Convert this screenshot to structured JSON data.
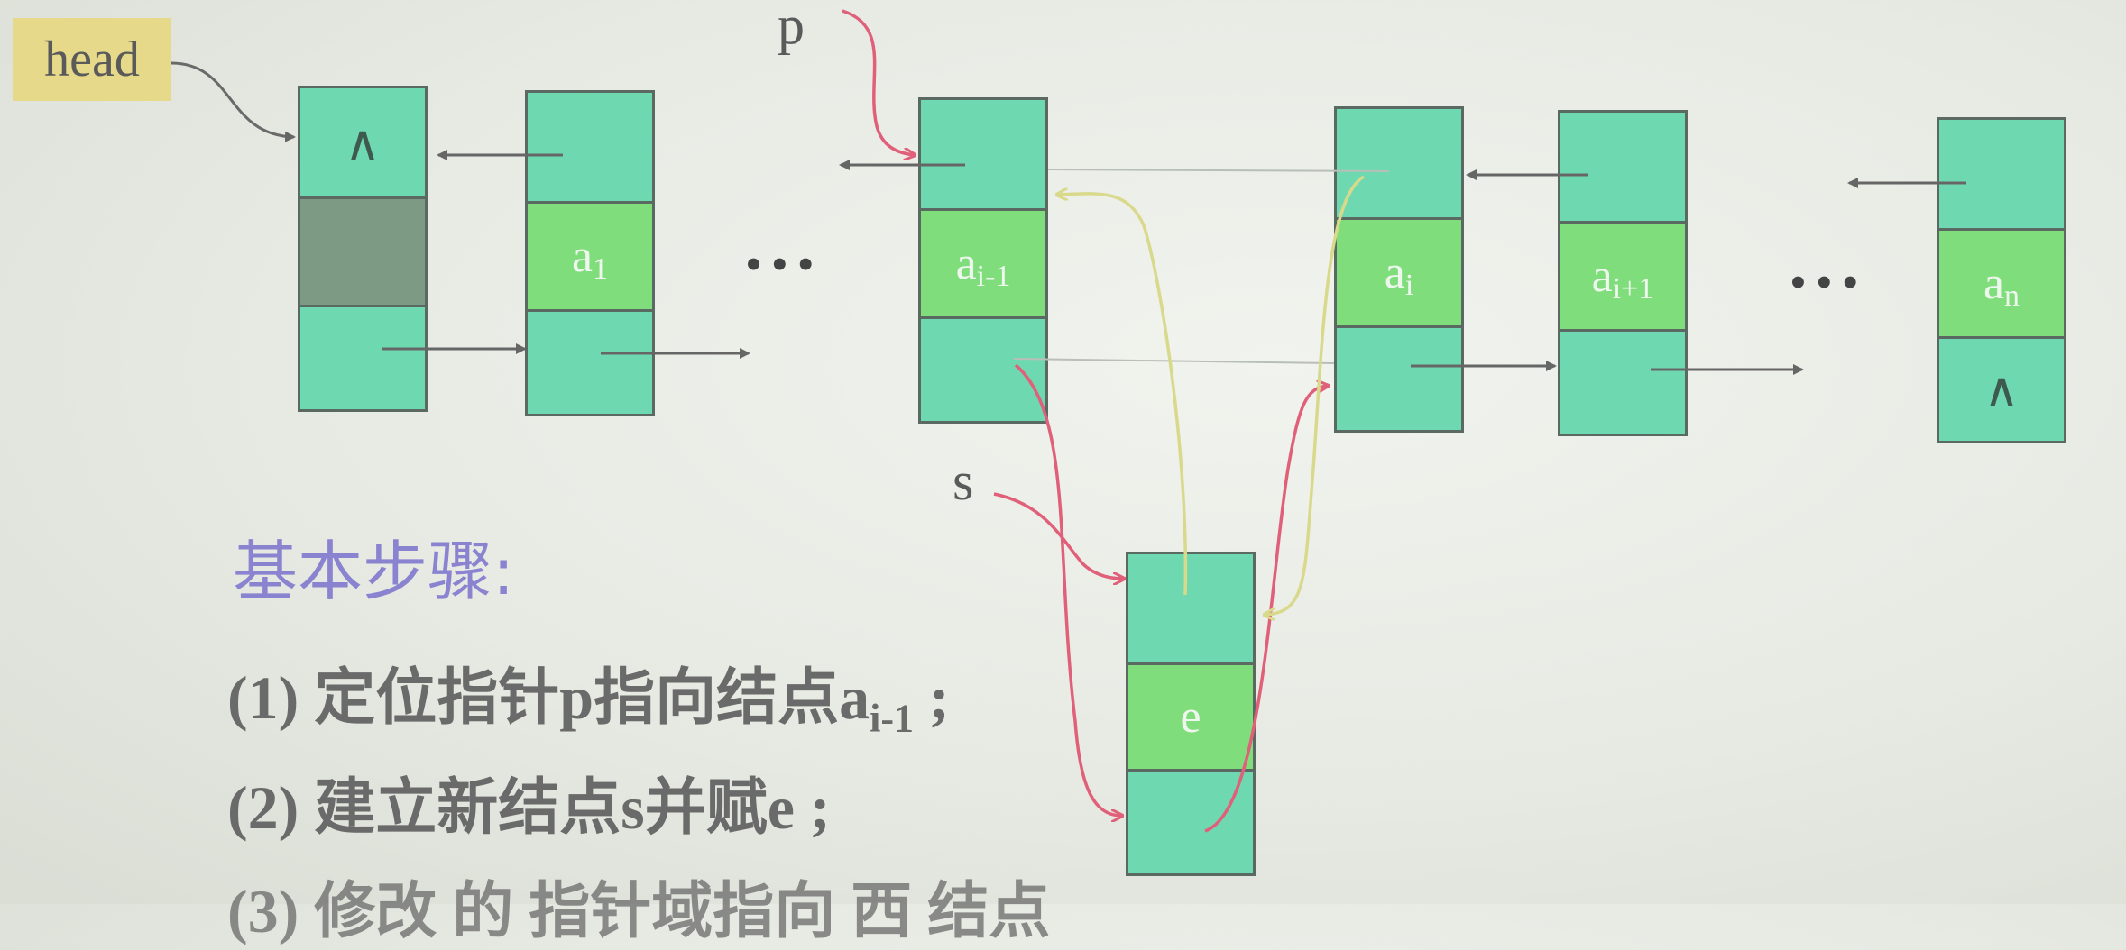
{
  "labels": {
    "head": "head",
    "p": "p",
    "s": "s",
    "ellipsis": "•••"
  },
  "nodes": {
    "head_node": {
      "prior": "∧",
      "data": "",
      "next": ""
    },
    "a1": {
      "data": "a",
      "sub": "1"
    },
    "a_im1": {
      "data": "a",
      "sub": "i-1"
    },
    "a_i": {
      "data": "a",
      "sub": "i"
    },
    "a_ip1": {
      "data": "a",
      "sub": "i+1"
    },
    "a_n": {
      "data": "a",
      "sub": "n",
      "next": "∧"
    },
    "new_node": {
      "data": "e"
    }
  },
  "steps": {
    "title": "基本步骤:",
    "step1_prefix": "(1) 定位指针p指向结点a",
    "step1_sub": "i-1",
    "step1_suffix": " ;",
    "step2": "(2) 建立新结点s并赋e ;",
    "step3_partial": "(3) 修改 的    指针域指向  西  结点"
  },
  "colors": {
    "node_cell": "#6ed9b1",
    "data_cell": "#80dd7c",
    "arrow_gray": "#666666",
    "arrow_red": "#e0607a",
    "arrow_yellow": "#e4e49a",
    "steps_title": "#8a84d0",
    "head_label_bg": "#e6d98a"
  }
}
